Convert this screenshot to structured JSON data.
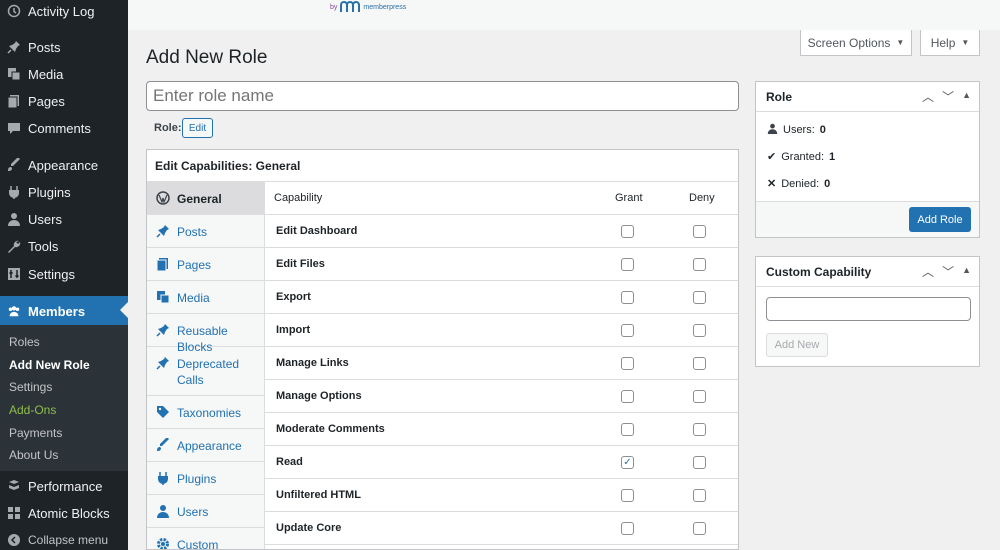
{
  "brand": {
    "by": "by",
    "name": "memberpress"
  },
  "sidebar": {
    "items": [
      {
        "label": "Activity Log",
        "icon": "clock-icon"
      },
      {
        "label": "Posts",
        "icon": "pin-icon"
      },
      {
        "label": "Media",
        "icon": "media-icon"
      },
      {
        "label": "Pages",
        "icon": "pages-icon"
      },
      {
        "label": "Comments",
        "icon": "comment-icon"
      },
      {
        "label": "Appearance",
        "icon": "brush-icon"
      },
      {
        "label": "Plugins",
        "icon": "plugin-icon"
      },
      {
        "label": "Users",
        "icon": "user-icon"
      },
      {
        "label": "Tools",
        "icon": "wrench-icon"
      },
      {
        "label": "Settings",
        "icon": "settings-icon"
      },
      {
        "label": "Members",
        "icon": "members-icon"
      },
      {
        "label": "Performance",
        "icon": "performance-icon"
      },
      {
        "label": "Atomic Blocks",
        "icon": "blocks-icon"
      },
      {
        "label": "Collapse menu",
        "icon": "collapse-icon"
      }
    ],
    "submenu": [
      "Roles",
      "Add New Role",
      "Settings",
      "Add-Ons",
      "Payments",
      "About Us"
    ]
  },
  "header": {
    "screen_options": "Screen Options",
    "help": "Help"
  },
  "page": {
    "title": "Add New Role",
    "role_placeholder": "Enter role name",
    "slug_label": "Role:",
    "edit_label": "Edit"
  },
  "capabilities": {
    "title": "Edit Capabilities: General",
    "tabs": [
      "General",
      "Posts",
      "Pages",
      "Media",
      "Reusable Blocks",
      "Deprecated Calls",
      "Taxonomies",
      "Appearance",
      "Plugins",
      "Users",
      "Custom"
    ],
    "columns": {
      "capability": "Capability",
      "grant": "Grant",
      "deny": "Deny"
    },
    "rows": [
      {
        "name": "Edit Dashboard",
        "grant": false,
        "deny": false
      },
      {
        "name": "Edit Files",
        "grant": false,
        "deny": false
      },
      {
        "name": "Export",
        "grant": false,
        "deny": false
      },
      {
        "name": "Import",
        "grant": false,
        "deny": false
      },
      {
        "name": "Manage Links",
        "grant": false,
        "deny": false
      },
      {
        "name": "Manage Options",
        "grant": false,
        "deny": false
      },
      {
        "name": "Moderate Comments",
        "grant": false,
        "deny": false
      },
      {
        "name": "Read",
        "grant": true,
        "deny": false
      },
      {
        "name": "Unfiltered HTML",
        "grant": false,
        "deny": false
      },
      {
        "name": "Update Core",
        "grant": false,
        "deny": false
      }
    ]
  },
  "role_panel": {
    "title": "Role",
    "users_label": "Users:",
    "users_count": "0",
    "granted_label": "Granted:",
    "granted_count": "1",
    "denied_label": "Denied:",
    "denied_count": "0",
    "add_role": "Add Role"
  },
  "custom_panel": {
    "title": "Custom Capability",
    "add_new": "Add New"
  },
  "colors": {
    "accent": "#2271b1",
    "sidebar": "#1d2327",
    "addons": "#8fbe4a"
  }
}
